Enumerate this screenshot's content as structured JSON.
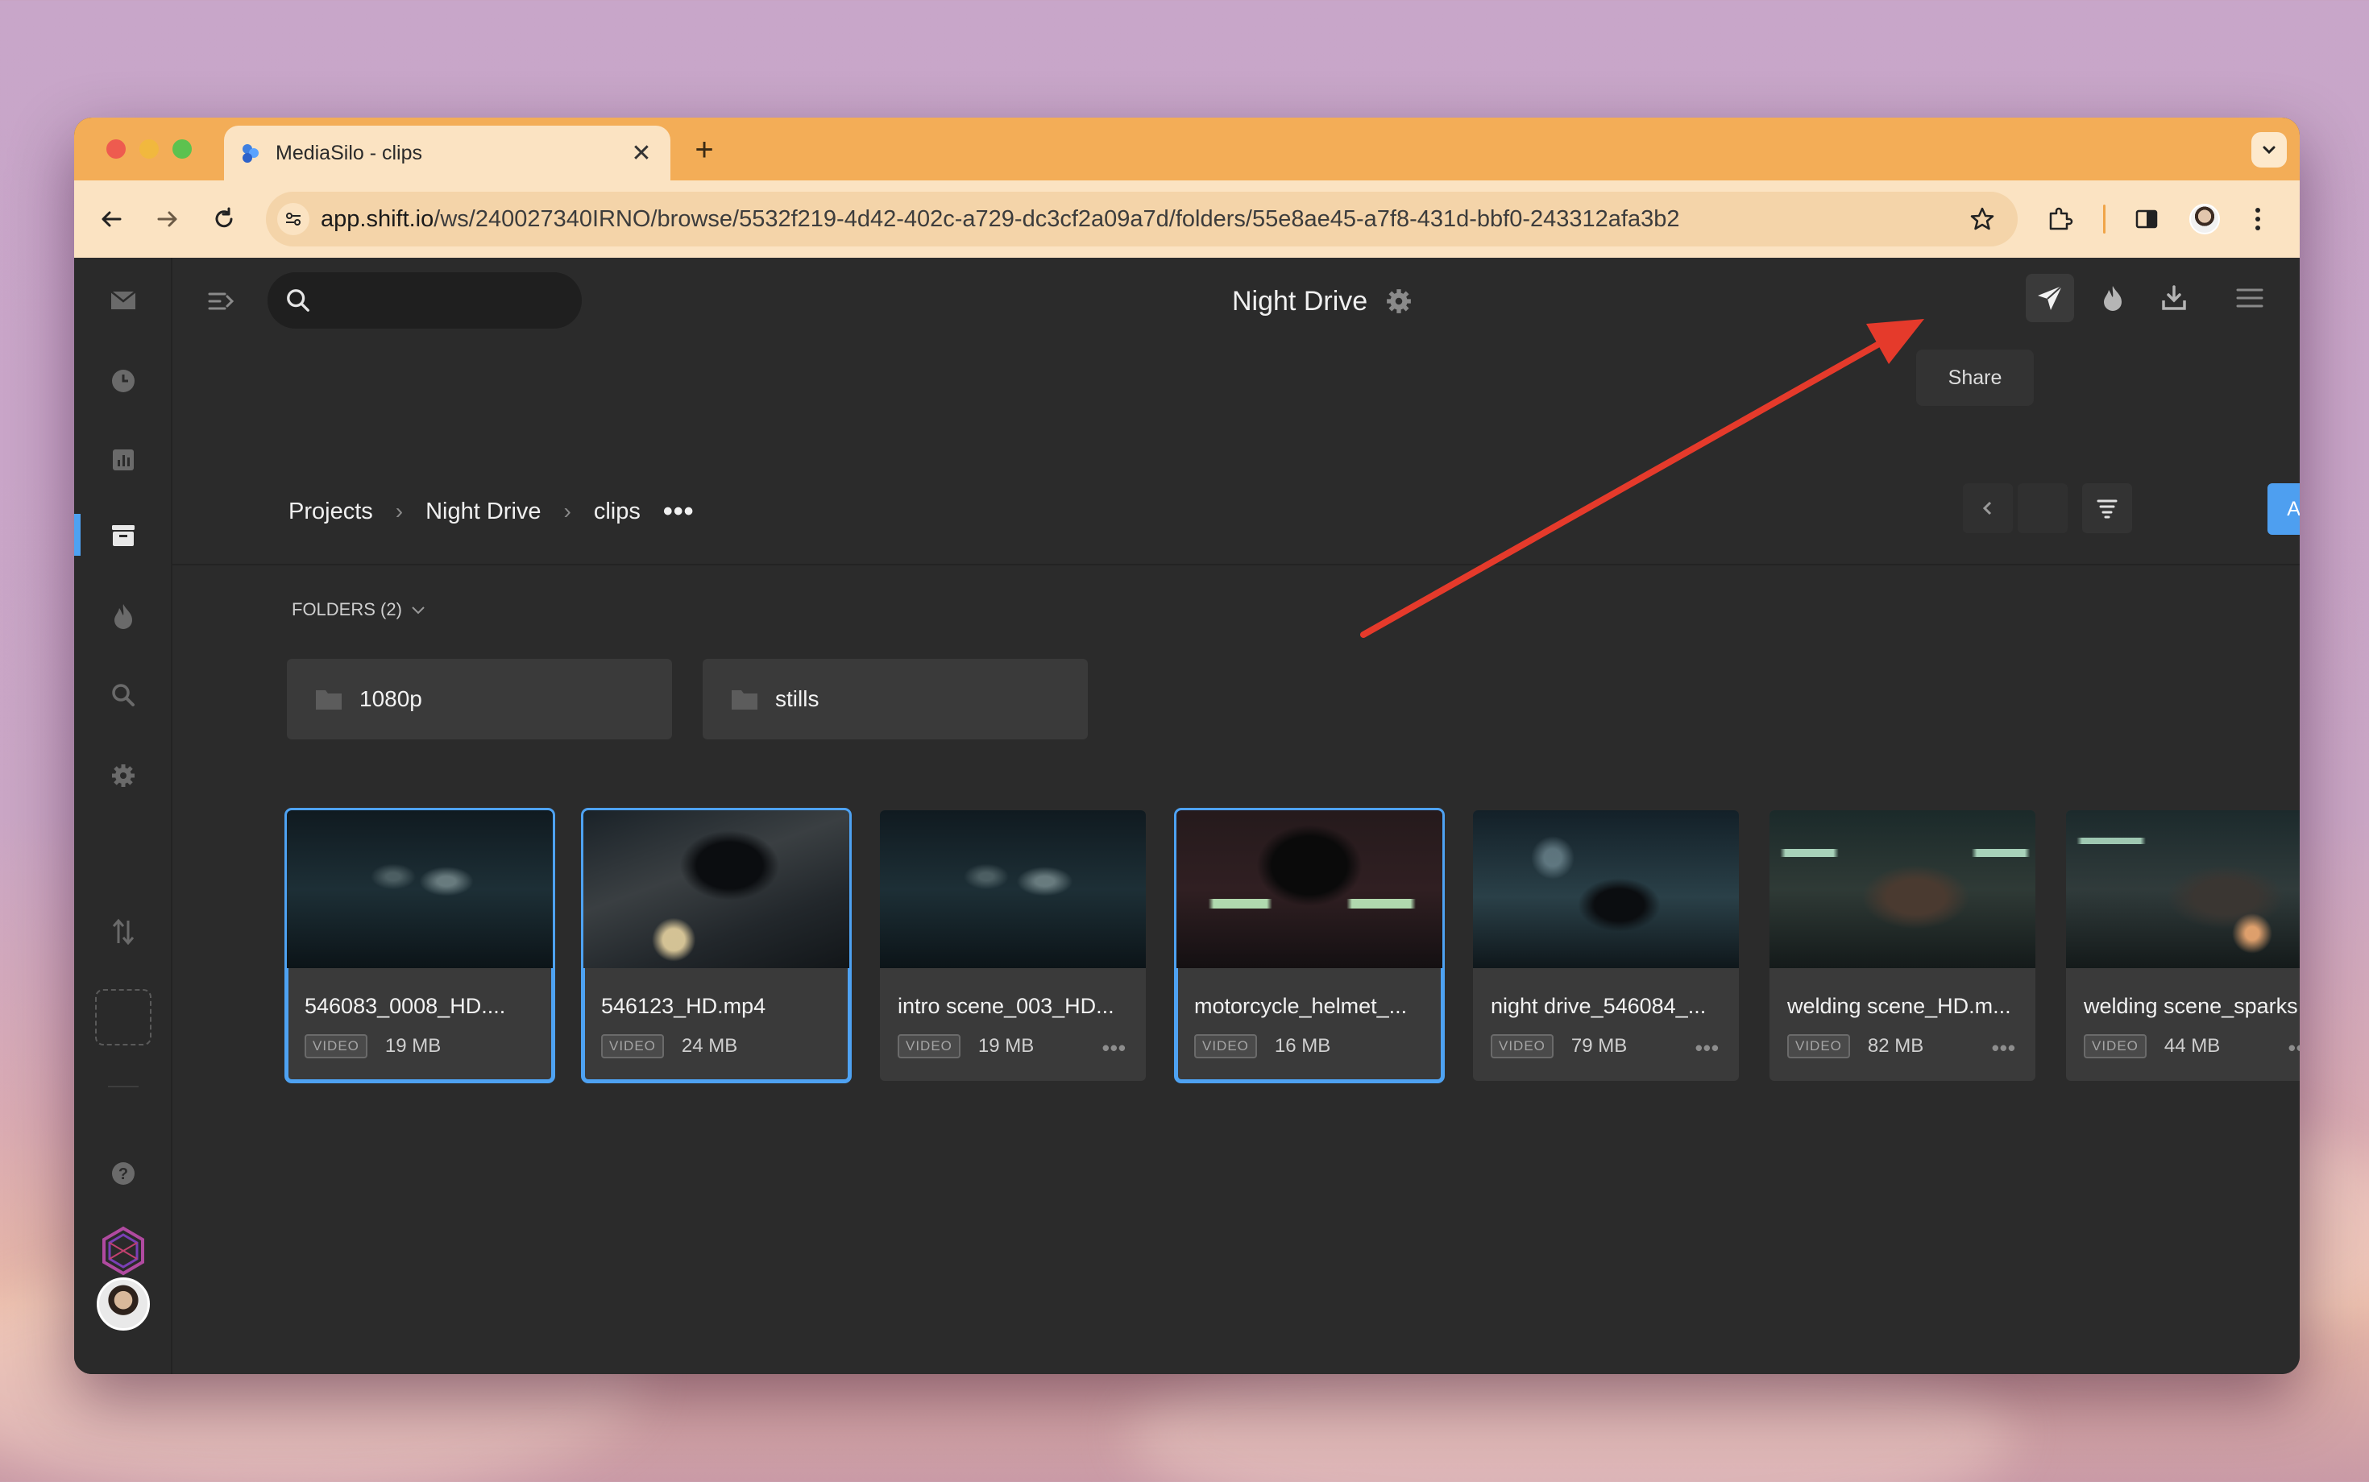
{
  "browser": {
    "tab_title": "MediaSilo - clips",
    "tab_close": "✕",
    "new_tab": "+",
    "url_host": "app.shift.io",
    "url_path": "/ws/240027340IRNO/browse/5532f219-4d42-402c-a729-dc3cf2a09a7d/folders/55e8ae45-a7f8-431d-bbf0-243312afa3b2"
  },
  "header": {
    "search_placeholder": "",
    "project_title": "Night Drive",
    "share_tooltip": "Share"
  },
  "breadcrumbs": {
    "items": [
      "Projects",
      "Night Drive",
      "clips"
    ],
    "more": "•••"
  },
  "actions": {
    "add_new_label": "Add New"
  },
  "folders": {
    "label": "FOLDERS (2)",
    "items": [
      {
        "name": "1080p"
      },
      {
        "name": "stills"
      }
    ]
  },
  "assets": [
    {
      "name": "546083_0008_HD....",
      "type": "VIDEO",
      "size": "19 MB",
      "selected": true
    },
    {
      "name": "546123_HD.mp4",
      "type": "VIDEO",
      "size": "24 MB",
      "selected": true
    },
    {
      "name": "intro scene_003_HD...",
      "type": "VIDEO",
      "size": "19 MB",
      "selected": false
    },
    {
      "name": "motorcycle_helmet_...",
      "type": "VIDEO",
      "size": "16 MB",
      "selected": true
    },
    {
      "name": "night drive_546084_...",
      "type": "VIDEO",
      "size": "79 MB",
      "selected": false
    },
    {
      "name": "welding scene_HD.m...",
      "type": "VIDEO",
      "size": "82 MB",
      "selected": false
    },
    {
      "name": "welding scene_sparks",
      "type": "VIDEO",
      "size": "44 MB",
      "selected": false
    }
  ],
  "card_more": "•••",
  "colors": {
    "accent": "#4ea2f2",
    "annotation_arrow": "#e53a2b",
    "tabbar": "#f3ad57"
  }
}
